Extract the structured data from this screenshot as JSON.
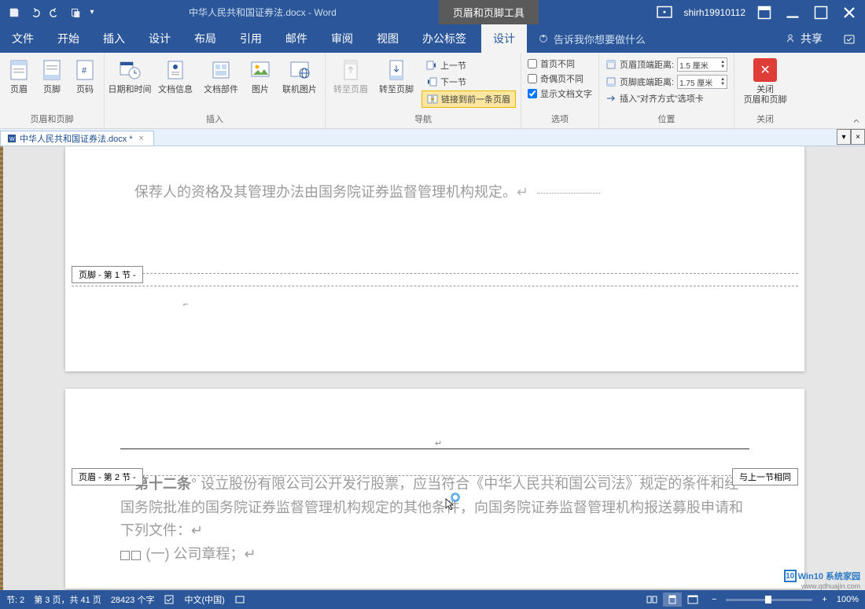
{
  "title": {
    "doc_name": "中华人民共和国证券法.docx  -  Word",
    "contextual": "页眉和页脚工具",
    "username": "shirh19910112"
  },
  "tabs": {
    "file": "文件",
    "home": "开始",
    "insert": "插入",
    "design": "设计",
    "layout": "布局",
    "references": "引用",
    "mailings": "邮件",
    "review": "审阅",
    "view": "视图",
    "office": "办公标签",
    "hf_design": "设计",
    "tellme": "告诉我你想要做什么",
    "share": "共享"
  },
  "ribbon": {
    "header": "页眉",
    "footer": "页脚",
    "page_number": "页码",
    "date_time": "日期和时间",
    "doc_info": "文档信息",
    "doc_parts": "文档部件",
    "picture": "图片",
    "online_pic": "联机图片",
    "goto_header": "转至页眉",
    "goto_footer": "转至页脚",
    "prev_section": "上一节",
    "next_section": "下一节",
    "link_prev": "链接到前一条页眉",
    "diff_first": "首页不同",
    "diff_odd_even": "奇偶页不同",
    "show_doc_text": "显示文档文字",
    "header_from_top": "页眉顶端距离:",
    "footer_from_bottom": "页脚底端距离:",
    "insert_align_tab": "插入\"对齐方式\"选项卡",
    "header_dist_val": "1.5 厘米",
    "footer_dist_val": "1.75 厘米",
    "close_hf": "关闭",
    "close_hf2": "页眉和页脚",
    "group_hf": "页眉和页脚",
    "group_insert": "插入",
    "group_nav": "导航",
    "group_options": "选项",
    "group_position": "位置",
    "group_close": "关闭"
  },
  "doc_tab": {
    "name": "中华人民共和国证券法.docx *"
  },
  "document": {
    "sponsor_line": "保荐人的资格及其管理办法由国务院证券监督管理机构规定。",
    "footer_tag_1": "页脚 - 第 1 节 -",
    "header_tag_2": "页眉 - 第 2 节 -",
    "same_as_prev": "与上一节相同",
    "article12": "第十二条",
    "article12_body": "°  设立股份有限公司公开发行股票，应当符合《中华人民共和国公司法》规定的条件和经国务院批准的国务院证券监督管理机构规定的其他条件，向国务院证券监督管理机构报送募股申请和下列文件：",
    "list_item_1": "(一) 公司章程；",
    "return_mark": "↵"
  },
  "status": {
    "section": "节: 2",
    "page": "第 3 页，共 41 页",
    "words": "28423 个字",
    "language": "中文(中国)",
    "zoom": "100%"
  },
  "watermark": {
    "brand1": "Win10",
    "brand2": "系统家园",
    "url": "www.qdhuajin.com"
  }
}
